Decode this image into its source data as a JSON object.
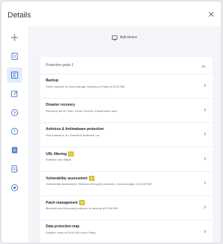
{
  "header": {
    "title": "Details"
  },
  "toolbar": {
    "add_label": "Add device"
  },
  "card": {
    "title": "Protection goals 1"
  },
  "rows": [
    {
      "name": "Backup",
      "desc": "Entire machine to Cloud storage, Monday to Friday at 23:00 NM",
      "flag": false
    },
    {
      "name": "Disaster recovery",
      "desc": "Recovery server: Auto, Cloud: Servers: Infrastructure auto",
      "flag": false
    },
    {
      "name": "Antivirus & Antimalware protection",
      "desc": "Self-protection: on, Real-time protection: on",
      "flag": false
    },
    {
      "name": "URL filtering",
      "desc": "Enabled, use default",
      "flag": true
    },
    {
      "name": "Vulnerability assessment",
      "desc": "Vulnerability assessment, Windows third-party products, Linux packages, at 23:00 NM",
      "flag": true
    },
    {
      "name": "Patch management",
      "desc": "Microsoft and third-party products, all severity at 23:00 NM",
      "flag": true
    },
    {
      "name": "Data protection map",
      "desc": "Enabled, scan at 23:00 NM every Friday",
      "flag": false
    }
  ],
  "rail": [
    {
      "name": "plus-icon"
    },
    {
      "name": "document-icon"
    },
    {
      "name": "dashboard-icon"
    },
    {
      "name": "edit-icon"
    },
    {
      "name": "clock-icon"
    },
    {
      "name": "alert-icon"
    },
    {
      "name": "report-icon"
    },
    {
      "name": "list-icon"
    },
    {
      "name": "settings-icon"
    }
  ],
  "colors": {
    "accent": "#2f6fd6",
    "badge": "#e8d44a"
  }
}
